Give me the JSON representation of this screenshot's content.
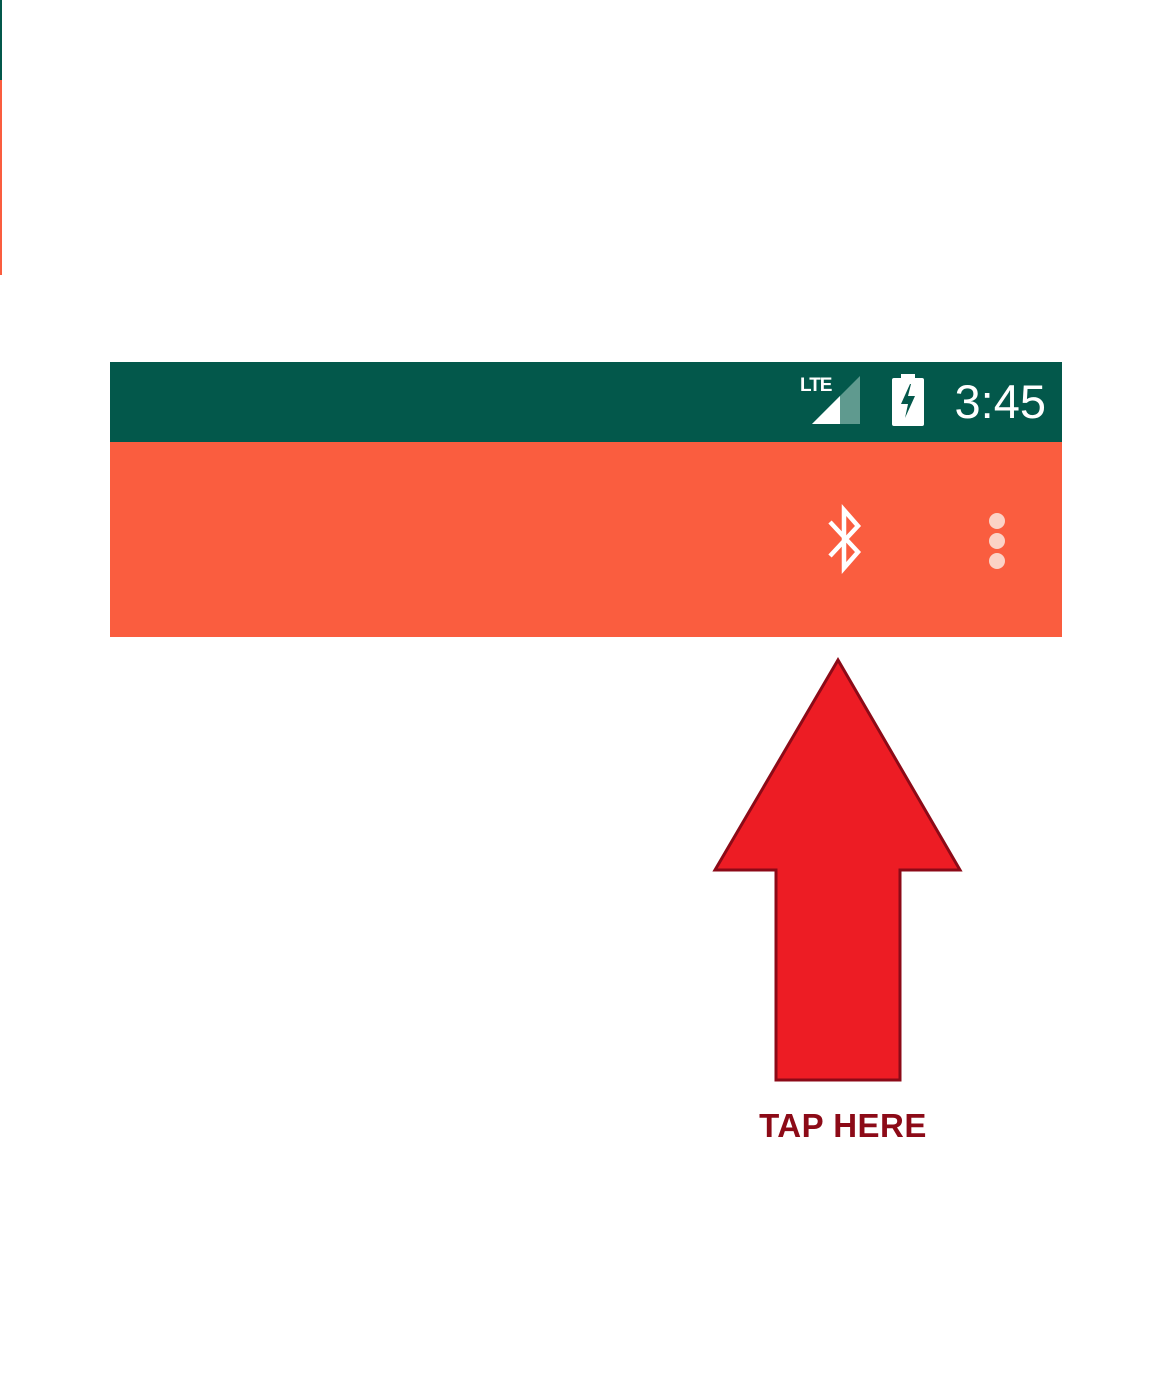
{
  "status_bar": {
    "network_label": "LTE",
    "time": "3:45",
    "icons": [
      "signal-icon",
      "battery-charging-icon"
    ]
  },
  "action_bar": {
    "icons": [
      "bluetooth-icon",
      "more-vert-icon"
    ]
  },
  "annotation": {
    "label": "TAP HERE",
    "icon": "up-arrow-icon"
  },
  "colors": {
    "status_bar": "#03584b",
    "action_bar": "#fa5d3f",
    "arrow_fill": "#ed1c24",
    "arrow_stroke": "#8c0a17",
    "label": "#8c0a17"
  }
}
